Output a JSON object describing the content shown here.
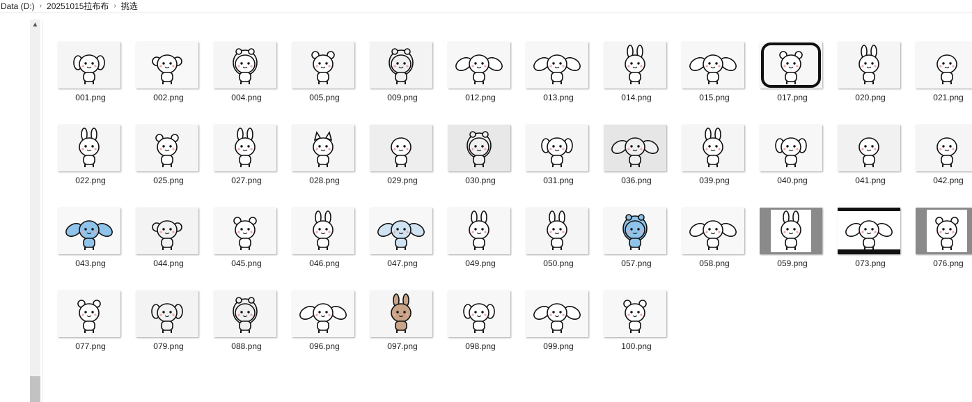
{
  "breadcrumb": [
    "Data (D:)",
    "20251015拉布布",
    "挑选"
  ],
  "files": [
    {
      "name": "001.png",
      "bg": "#f5f5f5",
      "ears": "floppy",
      "fill": "#ffffff",
      "frame": "none"
    },
    {
      "name": "002.png",
      "bg": "#f8f8f8",
      "ears": "round",
      "fill": "#ffffff",
      "frame": "none"
    },
    {
      "name": "004.png",
      "bg": "#f5f5f5",
      "ears": "hood",
      "fill": "#ffffff",
      "frame": "none"
    },
    {
      "name": "005.png",
      "bg": "#f5f5f5",
      "ears": "bear",
      "fill": "#ffffff",
      "frame": "none"
    },
    {
      "name": "009.png",
      "bg": "#f3f3f3",
      "ears": "hood",
      "fill": "#f0f0f0",
      "frame": "none"
    },
    {
      "name": "012.png",
      "bg": "#f7f7f7",
      "ears": "long",
      "fill": "#ffffff",
      "frame": "none"
    },
    {
      "name": "013.png",
      "bg": "#f7f7f7",
      "ears": "long",
      "fill": "#ffffff",
      "frame": "none"
    },
    {
      "name": "014.png",
      "bg": "#f5f5f5",
      "ears": "bunny",
      "fill": "#ffffff",
      "frame": "none"
    },
    {
      "name": "015.png",
      "bg": "#f7f7f7",
      "ears": "long",
      "fill": "#ffffff",
      "frame": "none"
    },
    {
      "name": "017.png",
      "bg": "#f7f7f7",
      "ears": "bear",
      "fill": "#ffffff",
      "frame": "thick"
    },
    {
      "name": "020.png",
      "bg": "#f5f5f5",
      "ears": "bunny",
      "fill": "#ffffff",
      "frame": "none"
    },
    {
      "name": "021.png",
      "bg": "#f7f7f7",
      "ears": "none",
      "fill": "#ffffff",
      "frame": "none"
    },
    {
      "name": "022.png",
      "bg": "#f5f5f5",
      "ears": "bunny",
      "fill": "#ffffff",
      "frame": "none"
    },
    {
      "name": "025.png",
      "bg": "#f5f5f5",
      "ears": "bear",
      "fill": "#ffffff",
      "frame": "none"
    },
    {
      "name": "027.png",
      "bg": "#f5f5f5",
      "ears": "bunny",
      "fill": "#ffffff",
      "frame": "none"
    },
    {
      "name": "028.png",
      "bg": "#f5f5f5",
      "ears": "cat",
      "fill": "#ffffff",
      "frame": "none"
    },
    {
      "name": "029.png",
      "bg": "#eeeeee",
      "ears": "none",
      "fill": "#ffffff",
      "frame": "none"
    },
    {
      "name": "030.png",
      "bg": "#e8e8e8",
      "ears": "hood",
      "fill": "#f0f0f0",
      "frame": "none"
    },
    {
      "name": "031.png",
      "bg": "#f5f5f5",
      "ears": "floppy",
      "fill": "#ffffff",
      "frame": "none"
    },
    {
      "name": "036.png",
      "bg": "#e6e6e6",
      "ears": "long",
      "fill": "#f0f0f0",
      "frame": "none"
    },
    {
      "name": "039.png",
      "bg": "#f5f5f5",
      "ears": "bunny",
      "fill": "#ffffff",
      "frame": "none"
    },
    {
      "name": "040.png",
      "bg": "#f7f7f7",
      "ears": "floppy",
      "fill": "#ffffff",
      "frame": "none"
    },
    {
      "name": "041.png",
      "bg": "#f1f1f1",
      "ears": "none",
      "fill": "#ffffff",
      "frame": "none"
    },
    {
      "name": "042.png",
      "bg": "#f5f5f5",
      "ears": "none",
      "fill": "#ffffff",
      "frame": "none"
    },
    {
      "name": "043.png",
      "bg": "#f8f8f8",
      "ears": "long",
      "fill": "#8fc3ea",
      "frame": "none"
    },
    {
      "name": "044.png",
      "bg": "#f3f3f3",
      "ears": "round",
      "fill": "#f2f2f2",
      "frame": "none"
    },
    {
      "name": "045.png",
      "bg": "#f7f7f7",
      "ears": "bear",
      "fill": "#ffffff",
      "frame": "none"
    },
    {
      "name": "046.png",
      "bg": "#f7f7f7",
      "ears": "bunny",
      "fill": "#ffffff",
      "frame": "none"
    },
    {
      "name": "047.png",
      "bg": "#f7f7f7",
      "ears": "long",
      "fill": "#cfe3f2",
      "frame": "none"
    },
    {
      "name": "049.png",
      "bg": "#f7f7f7",
      "ears": "bunny",
      "fill": "#ffffff",
      "frame": "none"
    },
    {
      "name": "050.png",
      "bg": "#f5f5f5",
      "ears": "bunny",
      "fill": "#ffffff",
      "frame": "none"
    },
    {
      "name": "057.png",
      "bg": "#f7f7f7",
      "ears": "hood",
      "fill": "#8fc3ea",
      "frame": "none"
    },
    {
      "name": "058.png",
      "bg": "#f8f8f8",
      "ears": "long",
      "fill": "#ffffff",
      "frame": "none"
    },
    {
      "name": "059.png",
      "bg": "#f7f7f7",
      "ears": "bunny",
      "fill": "#ffffff",
      "frame": "gray"
    },
    {
      "name": "073.png",
      "bg": "#ffffff",
      "ears": "long",
      "fill": "#ffffff",
      "frame": "black"
    },
    {
      "name": "076.png",
      "bg": "#ffffff",
      "ears": "bear",
      "fill": "#ffffff",
      "frame": "gray"
    },
    {
      "name": "077.png",
      "bg": "#f7f7f7",
      "ears": "bear",
      "fill": "#ffffff",
      "frame": "none"
    },
    {
      "name": "079.png",
      "bg": "#f3f3f3",
      "ears": "floppy",
      "fill": "#f2f2f2",
      "frame": "none"
    },
    {
      "name": "088.png",
      "bg": "#f5f5f5",
      "ears": "hood",
      "fill": "#f0f0f0",
      "frame": "none"
    },
    {
      "name": "096.png",
      "bg": "#f8f8f8",
      "ears": "long",
      "fill": "#ffffff",
      "frame": "none"
    },
    {
      "name": "097.png",
      "bg": "#f5f5f5",
      "ears": "bunny",
      "fill": "#c8a488",
      "frame": "none"
    },
    {
      "name": "098.png",
      "bg": "#f7f7f7",
      "ears": "floppy",
      "fill": "#ffffff",
      "frame": "none"
    },
    {
      "name": "099.png",
      "bg": "#f8f8f8",
      "ears": "long",
      "fill": "#ffffff",
      "frame": "none"
    },
    {
      "name": "100.png",
      "bg": "#f7f7f7",
      "ears": "bear",
      "fill": "#ffffff",
      "frame": "none"
    }
  ]
}
